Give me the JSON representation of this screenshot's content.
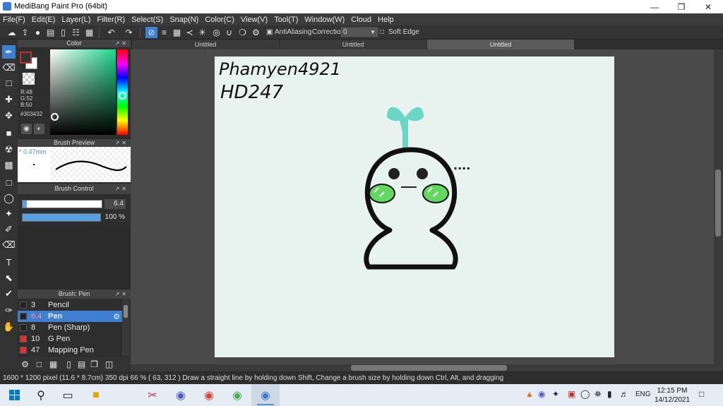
{
  "window": {
    "title": "MediBang Paint Pro (64bit)",
    "minimize_icon": "minimize-icon",
    "maximize_icon": "restore-icon",
    "close_icon": "close-icon"
  },
  "menu": [
    "File(F)",
    "Edit(E)",
    "Layer(L)",
    "Filter(R)",
    "Select(S)",
    "Snap(N)",
    "Color(C)",
    "View(V)",
    "Tool(T)",
    "Window(W)",
    "Cloud",
    "Help"
  ],
  "toolbar": {
    "antialiasing_label": "AntiAliasing",
    "correction_label": "Correction",
    "correction_value": "0",
    "soft_edge_label": "Soft Edge"
  },
  "color_panel": {
    "title": "Color",
    "r": "R:48",
    "g": "G:52",
    "b": "B:50",
    "hex": "#303432",
    "foreground": "#303432",
    "accent": "#1ed68d"
  },
  "brush_preview": {
    "title": "Brush Preview",
    "size": "* 0.47mm"
  },
  "brush_control": {
    "title": "Brush Control",
    "size_value": "6.4",
    "size_fill": 0.05,
    "opacity_value": "100 %",
    "opacity_fill": 1.0
  },
  "brush_list": {
    "title": "Brush: Pen",
    "items": [
      {
        "size": "3",
        "name": "Pencil",
        "color": "#222222"
      },
      {
        "size": "6.4",
        "name": "Pen",
        "color": "#222222",
        "selected": true
      },
      {
        "size": "8",
        "name": "Pen (Sharp)",
        "color": "#222222"
      },
      {
        "size": "10",
        "name": "G Pen",
        "color": "#e03030"
      },
      {
        "size": "47",
        "name": "Mapping Pen",
        "color": "#e03030"
      }
    ]
  },
  "tabs": [
    "Untitled",
    "Untitled",
    "Untitled"
  ],
  "canvas": {
    "handwriting_line1": "Phamyen4921",
    "handwriting_line2": "HD247",
    "dots": "...."
  },
  "status": {
    "text": "1600 * 1200 pixel   (11.6 * 8.7cm)   350 dpi   66 %   ( 63, 312 )   Draw a straight line by holding down Shift, Change a brush size by holding down Ctrl, Alt, and dragging"
  },
  "taskbar": {
    "language": "ENG",
    "time": "12:15 PM",
    "date": "14/12/2021"
  }
}
